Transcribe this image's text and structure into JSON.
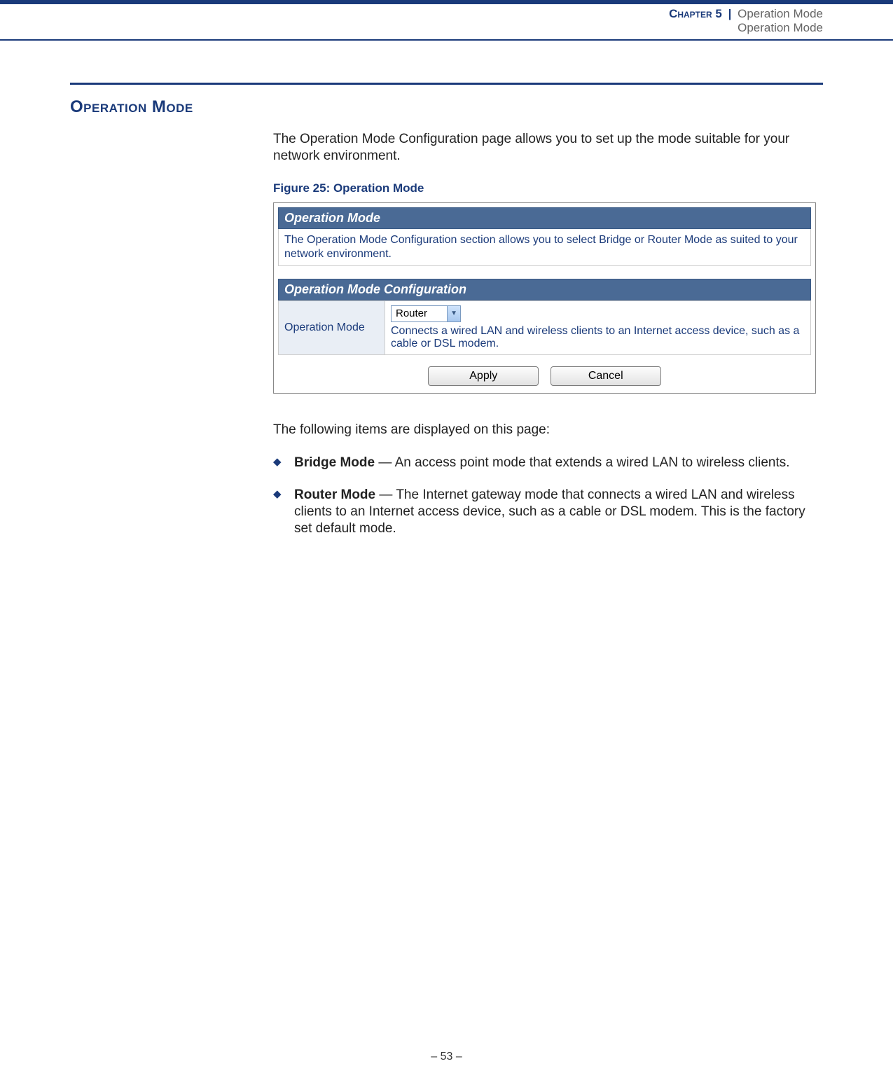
{
  "header": {
    "chapter_label": "Chapter 5",
    "pipe": "|",
    "chapter_title": "Operation Mode",
    "subtitle": "Operation Mode"
  },
  "section": {
    "title": "Operation Mode",
    "intro": "The Operation Mode Configuration page allows you to set up the mode suitable for your network environment.",
    "figure_caption": "Figure 25:  Operation Mode",
    "screenshot": {
      "panel1_title": "Operation Mode",
      "panel1_text": "The Operation Mode Configuration section allows you to select Bridge or Router Mode as suited to your network environment.",
      "panel2_title": "Operation Mode Configuration",
      "row_label": "Operation Mode",
      "select_value": "Router",
      "row_description": "Connects a wired LAN and wireless clients to an Internet access device, such as a cable or DSL modem.",
      "apply_label": "Apply",
      "cancel_label": "Cancel"
    },
    "items_intro": "The following items are displayed on this page:",
    "bullets": [
      {
        "term": "Bridge Mode",
        "sep": " — ",
        "desc": "An access point mode that extends a wired LAN to wireless clients."
      },
      {
        "term": "Router Mode",
        "sep": " — ",
        "desc": "The Internet gateway mode that connects a wired LAN and wireless clients to an Internet access device, such as a cable or DSL modem. This is the factory set default mode."
      }
    ]
  },
  "footer": {
    "page": "–  53  –"
  }
}
